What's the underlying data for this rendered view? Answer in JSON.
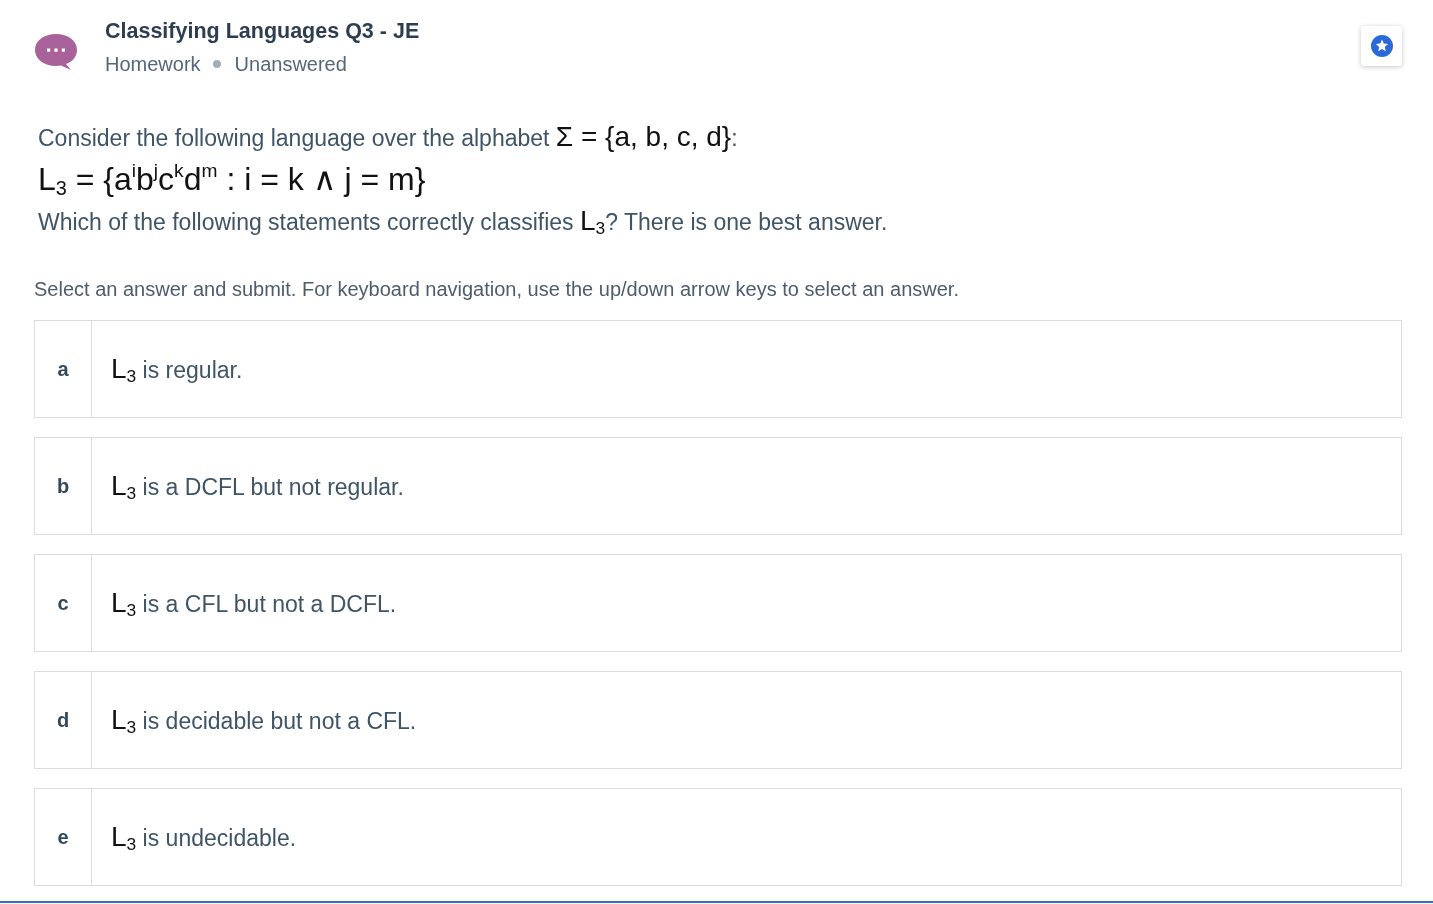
{
  "header": {
    "title": "Classifying Languages Q3 - JE",
    "category": "Homework",
    "status": "Unanswered"
  },
  "question": {
    "lines": [
      {
        "kind": "inline",
        "segments": [
          {
            "kind": "text",
            "text": "Consider the following language over the alphabet "
          },
          {
            "kind": "math",
            "text": "Σ = {a, b, c, d}"
          },
          {
            "kind": "text",
            "text": ":"
          }
        ]
      },
      {
        "kind": "display",
        "segments": [
          {
            "kind": "math",
            "text": "L$_{3}$ = {a$^{i}$b$^{j}$c$^{k}$d$^{m}$ : i = k ∧ j = m}"
          }
        ]
      },
      {
        "kind": "inline",
        "segments": [
          {
            "kind": "text",
            "text": "Which of the following statements correctly classifies "
          },
          {
            "kind": "math",
            "text": "L$_{3}$"
          },
          {
            "kind": "text",
            "text": "? There is one best answer."
          }
        ]
      }
    ]
  },
  "instructions": "Select an answer and submit. For keyboard navigation, use the up/down arrow keys to select an answer.",
  "options": [
    {
      "letter": "a",
      "selected": false,
      "segments": [
        {
          "kind": "math",
          "text": "L$_{3}$"
        },
        {
          "kind": "text",
          "text": " is regular."
        }
      ]
    },
    {
      "letter": "b",
      "selected": false,
      "segments": [
        {
          "kind": "math",
          "text": "L$_{3}$"
        },
        {
          "kind": "text",
          "text": " is a DCFL but not regular."
        }
      ]
    },
    {
      "letter": "c",
      "selected": false,
      "segments": [
        {
          "kind": "math",
          "text": "L$_{3}$"
        },
        {
          "kind": "text",
          "text": " is a CFL but not a DCFL."
        }
      ]
    },
    {
      "letter": "d",
      "selected": false,
      "segments": [
        {
          "kind": "math",
          "text": "L$_{3}$"
        },
        {
          "kind": "text",
          "text": " is decidable but not a CFL."
        }
      ]
    },
    {
      "letter": "e",
      "selected": false,
      "segments": [
        {
          "kind": "math",
          "text": "L$_{3}$"
        },
        {
          "kind": "text",
          "text": " is undecidable."
        }
      ]
    }
  ]
}
